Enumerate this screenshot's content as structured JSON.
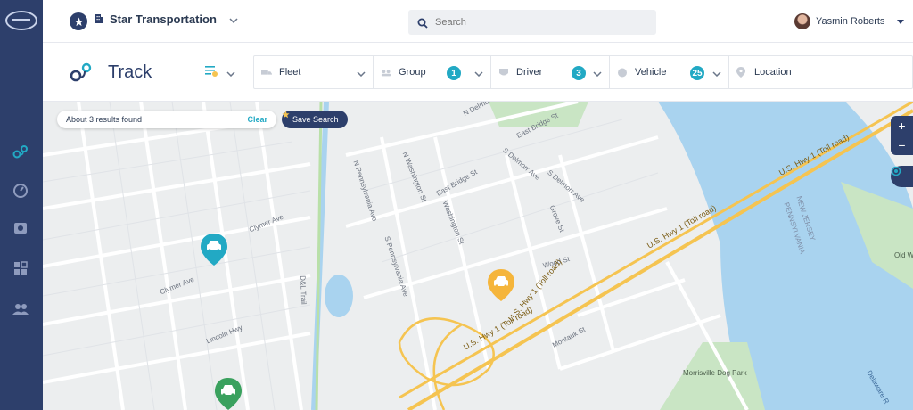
{
  "app": {
    "company_name": "Star Transportation",
    "user_name": "Yasmin Roberts",
    "search_placeholder": "Search"
  },
  "page": {
    "title": "Track"
  },
  "filters": [
    {
      "label": "Fleet",
      "icon": "truck-icon",
      "count": null
    },
    {
      "label": "Group",
      "icon": "group-icon",
      "count": "1"
    },
    {
      "label": "Driver",
      "icon": "driver-icon",
      "count": "3"
    },
    {
      "label": "Vehicle",
      "icon": "vehicle-icon",
      "count": "25"
    },
    {
      "label": "Location",
      "icon": "location-pin-icon",
      "count": null
    }
  ],
  "map": {
    "results_text": "About 3 results found",
    "clear_label": "Clear",
    "save_search_label": "Save Search",
    "zoom_in": "+",
    "zoom_out": "−",
    "labels": {
      "east_bridge_st": "East Bridge St",
      "n_delmorr_ave": "N Delmorr Ave",
      "s_delmorr_ave": "S Delmorr Ave",
      "s_delmorr_ave_2": "S Delmorr Ave",
      "n_pennsylvania_ave": "N Pennsylvania Ave",
      "s_pennsylvania_ave": "S Pennsylvania Ave",
      "n_washington_st": "N Washington St",
      "washington_st": "Washington St",
      "clymer_ave": "Clymer Ave",
      "clymer_ave_2": "Clymer Ave",
      "lincoln_hwy": "Lincoln Hwy",
      "us_hwy_1_a": "U.S. Hwy 1 (Toll road)",
      "us_hwy_1_b": "U.S. Hwy 1 (Toll road)",
      "us_hwy_1_c": "U.S. Hwy 1 (Toll road)",
      "us_hwy_1_d": "U.S. Hwy 1 (Toll road)",
      "new_jersey": "NEW JERSEY",
      "pennsylvania": "PENNSYLVANIA",
      "morrisville_dog_park": "Morrisville Dog Park",
      "delaware_river": "Delaware R",
      "old_w": "Old W",
      "montauk_st": "Montauk St",
      "wood_st": "Wood St",
      "grove_st": "Grove St",
      "ddl_trail": "D&L Trail"
    }
  },
  "vehicles": [
    {
      "name": "car-marker-teal",
      "color": "#22a9c4"
    },
    {
      "name": "car-marker-orange",
      "color": "#f5b53b"
    },
    {
      "name": "car-marker-green",
      "color": "#3aa15e"
    }
  ],
  "colors": {
    "sidebar": "#2d3f6b",
    "accent": "#22a9c4",
    "water": "#a9d3ef",
    "park": "#c9e5c4",
    "highway": "#f5c451"
  }
}
